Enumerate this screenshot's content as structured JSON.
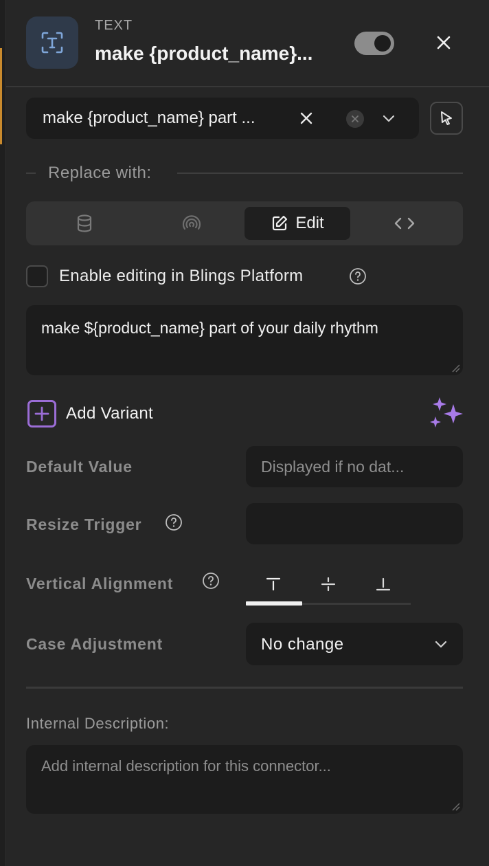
{
  "header": {
    "type_label": "TEXT",
    "title": "make {product_name}...",
    "toggle_on": true
  },
  "selector": {
    "value": "make {product_name} part ..."
  },
  "replace_with": {
    "label": "Replace with:",
    "tabs": [
      {
        "icon": "database-icon",
        "label": ""
      },
      {
        "icon": "broadcast-icon",
        "label": ""
      },
      {
        "icon": "edit-icon",
        "label": "Edit",
        "active": true
      },
      {
        "icon": "code-icon",
        "label": ""
      }
    ]
  },
  "enable_editing": {
    "label": "Enable editing in Blings Platform",
    "checked": false
  },
  "text_value": "make ${product_name} part of your daily rhythm",
  "add_variant": {
    "label": "Add Variant"
  },
  "fields": {
    "default_value": {
      "label": "Default Value",
      "placeholder": "Displayed if no dat..."
    },
    "resize_trigger": {
      "label": "Resize Trigger",
      "value": ""
    },
    "vertical_alignment": {
      "label": "Vertical Alignment",
      "options": [
        "align-top-icon",
        "align-center-icon",
        "align-bottom-icon"
      ],
      "selected": 0
    },
    "case_adjustment": {
      "label": "Case Adjustment",
      "value": "No change"
    }
  },
  "internal_description": {
    "label": "Internal Description:",
    "placeholder": "Add internal description for this connector..."
  },
  "colors": {
    "background": "#262626",
    "input_bg": "#1c1c1c",
    "accent_purple": "#9b6dd6",
    "header_icon_bg": "#2f3a4a",
    "left_accent": "#c98a2d"
  }
}
